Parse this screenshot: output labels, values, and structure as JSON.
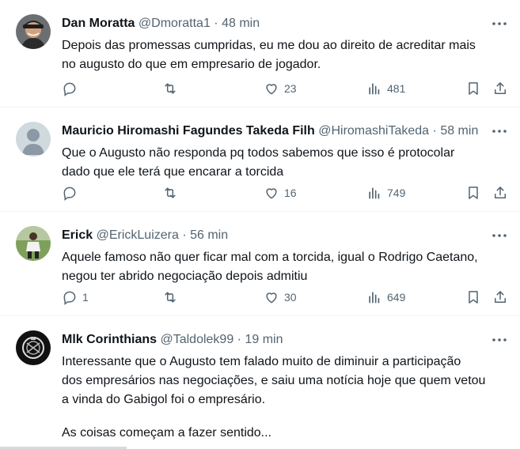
{
  "tweets": [
    {
      "name": "Dan Moratta",
      "handle": "@Dmoratta1",
      "dot": "·",
      "time": "48 min",
      "lines": [
        "Depois das promessas cumpridas, eu me dou ao direito de acreditar mais",
        "no augusto do que em empresario de jogador."
      ],
      "replies": "",
      "retweets": "",
      "likes": "23",
      "views": "481",
      "avatar": "man-with-cap-photo"
    },
    {
      "name": "Mauricio Hiromashi Fagundes Takeda Filh",
      "handle": "@HiromashiTakeda",
      "dot": "·",
      "time": "58 min",
      "lines": [
        "Que o Augusto não responda pq todos sabemos que isso é protocolar",
        "dado que ele terá que encarar a torcida"
      ],
      "replies": "",
      "retweets": "",
      "likes": "16",
      "views": "749",
      "avatar": "default-profile-placeholder"
    },
    {
      "name": "Erick",
      "handle": "@ErickLuizera",
      "dot": "·",
      "time": "56 min",
      "lines": [
        "Aquele famoso não quer ficar mal com a torcida, igual o Rodrigo Caetano,",
        "negou ter abrido negociação depois admitiu"
      ],
      "replies": "1",
      "retweets": "",
      "likes": "30",
      "views": "649",
      "avatar": "football-player-photo"
    },
    {
      "name": "Mlk Corinthians",
      "handle": "@Taldolek99",
      "dot": "·",
      "time": "19 min",
      "lines": [
        "Interessante que o Augusto tem falado muito de diminuir a participação",
        "dos empresários nas negociações, e saiu uma notícia hoje que quem vetou",
        "a vinda do Gabigol foi o empresário."
      ],
      "extra_line": "As coisas começam a fazer sentido...",
      "avatar": "corinthians-crest"
    }
  ],
  "colors": {
    "text": "#0f1419",
    "secondary": "#536471",
    "divider": "#eff3f4"
  }
}
